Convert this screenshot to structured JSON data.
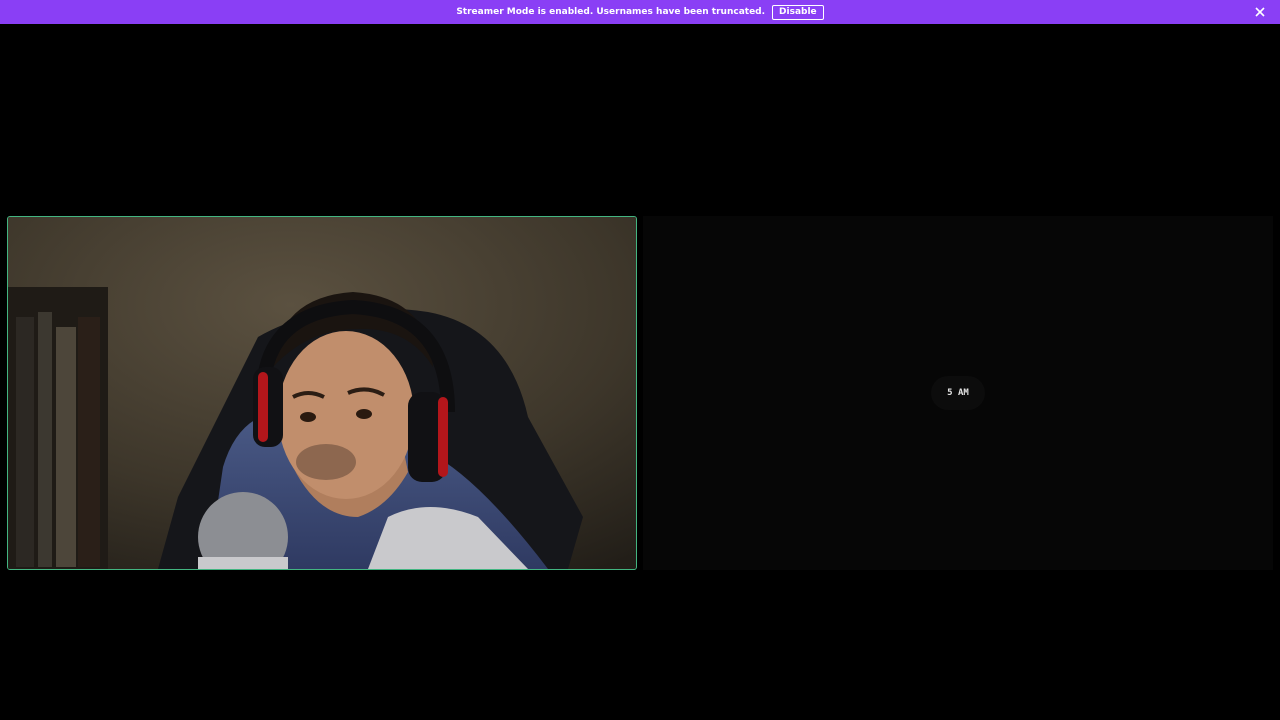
{
  "banner": {
    "message": "Streamer Mode is enabled. Usernames have been truncated.",
    "disable_label": "Disable",
    "close_icon": "close-icon",
    "background": "#8a3ff5"
  },
  "call": {
    "speaking_border_color": "#43b581",
    "webcam_tile": {
      "content": "webcam-feed"
    },
    "second_tile": {
      "avatar_text": "5 AM"
    }
  }
}
